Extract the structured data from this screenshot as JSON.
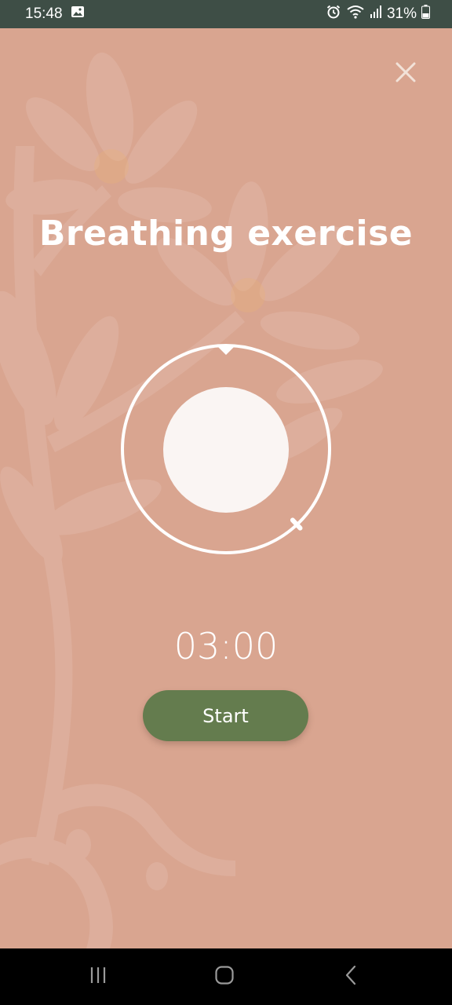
{
  "status_bar": {
    "time": "15:48",
    "battery": "31%",
    "icons": [
      "gallery-icon",
      "alarm-icon",
      "wifi-icon",
      "signal-icon",
      "battery-icon"
    ]
  },
  "screen": {
    "title": "Breathing exercise",
    "timer": "03:00",
    "start_label": "Start",
    "close_icon": "close-icon"
  },
  "breathing_indicator": {
    "progress": 0.38
  },
  "nav_bar": {
    "icons": [
      "recents-icon",
      "home-icon",
      "back-icon"
    ]
  },
  "colors": {
    "background": "#d9a590",
    "status_bar": "#3e4e46",
    "button": "#647c4e",
    "ring": "#ffffff",
    "orb": "#faf5f3"
  }
}
